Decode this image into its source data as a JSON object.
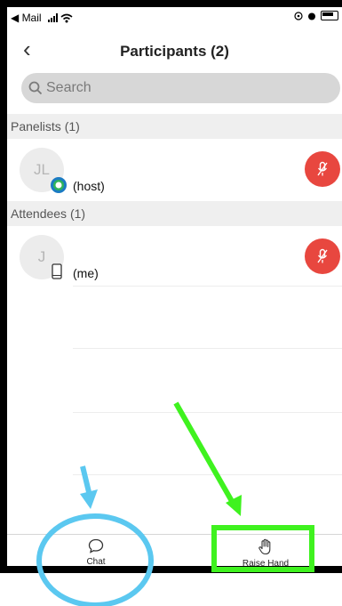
{
  "status_bar": {
    "back_app": "◀ Mail"
  },
  "nav": {
    "title": "Participants (2)"
  },
  "search": {
    "placeholder": "Search"
  },
  "sections": {
    "panelists": "Panelists (1)",
    "attendees": "Attendees (1)"
  },
  "panelist": {
    "initials": "JL",
    "label": "(host)"
  },
  "attendee": {
    "initials": "J",
    "label": "(me)"
  },
  "tabbar": {
    "chat_label": "Chat",
    "raise_hand_label": "Raise Hand"
  },
  "colors": {
    "mute_red": "#e8473f",
    "search_bg": "#d7d7d7",
    "annotation_blue": "#5bc8f0",
    "annotation_green": "#3ff21f"
  },
  "icons": [
    "back-chevron-icon",
    "search-icon",
    "mic-muted-icon",
    "phone-device-icon",
    "chat-bubble-icon",
    "raise-hand-icon"
  ]
}
